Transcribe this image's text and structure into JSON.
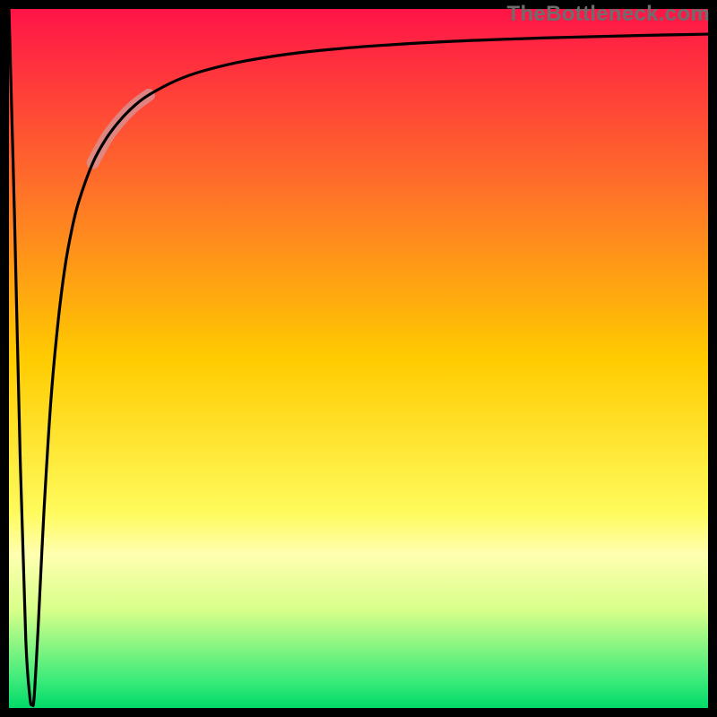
{
  "watermark": "TheBottleneck.com",
  "chart_data": {
    "type": "line",
    "title": "",
    "xlabel": "",
    "ylabel": "",
    "xlim": [
      0,
      100
    ],
    "ylim": [
      0,
      100
    ],
    "grid": false,
    "legend": false,
    "background_gradient": {
      "stops": [
        {
          "offset": 0.0,
          "color": "#FF1447"
        },
        {
          "offset": 0.25,
          "color": "#FF6E2A"
        },
        {
          "offset": 0.5,
          "color": "#FFCB00"
        },
        {
          "offset": 0.72,
          "color": "#FFFB5C"
        },
        {
          "offset": 0.78,
          "color": "#FFFFB0"
        },
        {
          "offset": 0.86,
          "color": "#D8FF8A"
        },
        {
          "offset": 0.96,
          "color": "#3CEB7A"
        },
        {
          "offset": 1.0,
          "color": "#00D968"
        }
      ]
    },
    "series": [
      {
        "name": "bottleneck-curve",
        "x": [
          0.0,
          0.8,
          1.6,
          2.4,
          3.0,
          3.3,
          3.6,
          4.2,
          5.0,
          6.0,
          7.0,
          8.0,
          9.0,
          10.0,
          12.0,
          14.0,
          16.0,
          18.0,
          20.0,
          24.0,
          28.0,
          34.0,
          42.0,
          52.0,
          64.0,
          78.0,
          90.0,
          100.0
        ],
        "y": [
          100.0,
          70.0,
          36.0,
          10.0,
          1.5,
          0.6,
          1.5,
          12.0,
          28.0,
          44.0,
          55.0,
          63.0,
          68.5,
          72.5,
          78.0,
          81.6,
          84.2,
          86.2,
          87.7,
          89.8,
          91.2,
          92.6,
          93.8,
          94.7,
          95.4,
          95.9,
          96.2,
          96.4
        ]
      }
    ],
    "highlight_segment": {
      "series": "bottleneck-curve",
      "x_start": 12.0,
      "x_end": 20.0,
      "color": "#D98E8E",
      "width": 14
    },
    "frame": {
      "stroke": "#000000",
      "stroke_width": 10
    },
    "curve_style": {
      "stroke": "#000000",
      "stroke_width": 3.2
    }
  }
}
